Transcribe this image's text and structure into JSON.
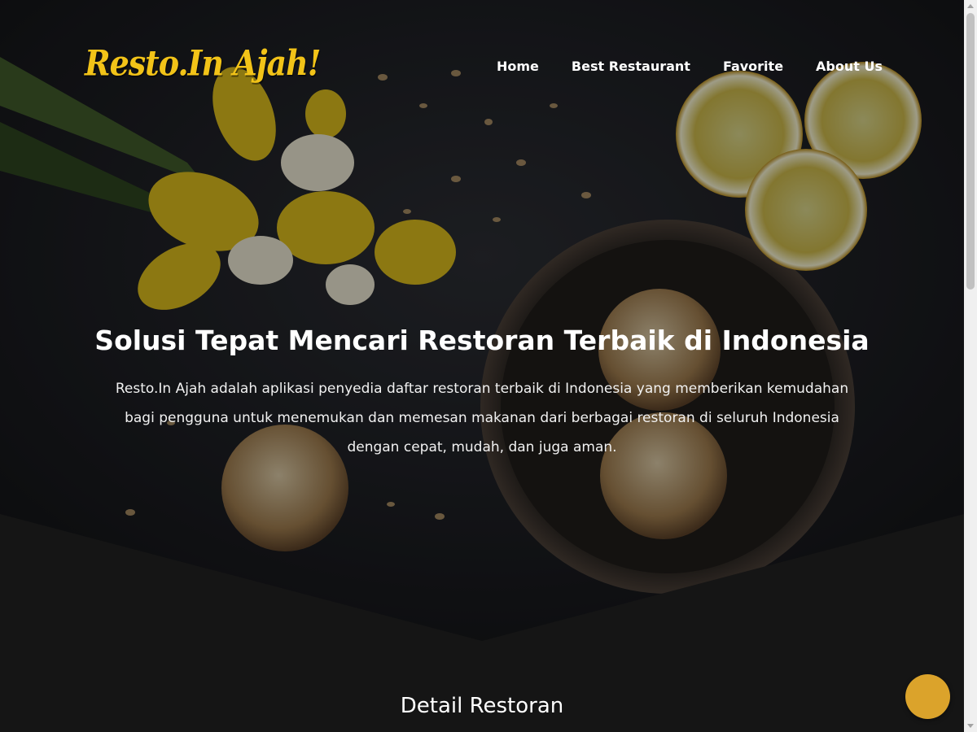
{
  "header": {
    "logo": "Resto.In Ajah!",
    "nav": [
      {
        "label": "Home"
      },
      {
        "label": "Best Restaurant"
      },
      {
        "label": "Favorite"
      },
      {
        "label": "About Us"
      }
    ]
  },
  "hero": {
    "title": "Solusi Tepat Mencari Restoran Terbaik di Indonesia",
    "description": "Resto.In Ajah adalah aplikasi penyedia daftar restoran terbaik di Indonesia yang memberikan kemudahan bagi pengguna untuk menemukan dan memesan makanan dari berbagai restoran di seluruh Indonesia dengan cepat, mudah, dan juga aman."
  },
  "section": {
    "title": "Detail Restoran"
  },
  "colors": {
    "brand": "#f2c318",
    "accent": "#dba32b",
    "background": "#151515"
  }
}
